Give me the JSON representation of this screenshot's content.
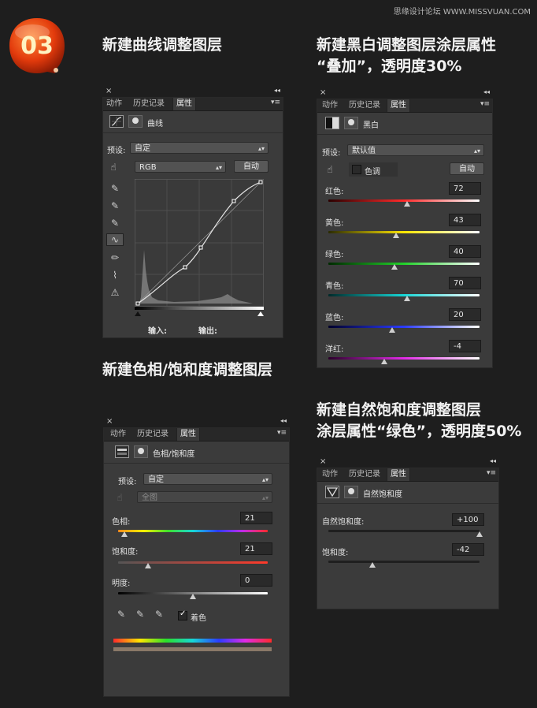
{
  "watermark": "思缘设计论坛 WWW.MISSVUAN.COM",
  "badge": {
    "text": "03",
    "color": "#e23a0c"
  },
  "headings": {
    "h1": "新建曲线调整图层",
    "h2_line1": "新建黑白调整图层涂层属性",
    "h2_line2": "“叠加”，透明度30%",
    "h3": "新建色相/饱和度调整图层",
    "h4_line1": "新建自然饱和度调整图层",
    "h4_line2": "涂层属性“绿色”，透明度50%"
  },
  "tabs": {
    "actions": "动作",
    "history": "历史记录",
    "properties": "属性"
  },
  "icons": {
    "close": "×",
    "collapse": "◂◂",
    "menu": "▾≡",
    "arrows": "▴▾"
  },
  "curves": {
    "title": "曲线",
    "preset_label": "预设:",
    "preset_value": "自定",
    "channel_value": "RGB",
    "auto_button": "自动",
    "input_label": "输入:",
    "output_label": "输出:"
  },
  "bw": {
    "title": "黑白",
    "preset_label": "预设:",
    "preset_value": "默认值",
    "tint_label": "色调",
    "auto_button": "自动",
    "sliders": [
      {
        "label": "红色:",
        "value": "72",
        "pos": 0.52,
        "gradient": "linear-gradient(to right,#2a0000,#ff2a2a,#fff)"
      },
      {
        "label": "黄色:",
        "value": "43",
        "pos": 0.45,
        "gradient": "linear-gradient(to right,#2a2a00,#ffe600,#fff)"
      },
      {
        "label": "绿色:",
        "value": "40",
        "pos": 0.44,
        "gradient": "linear-gradient(to right,#002a00,#22d12a,#fff)"
      },
      {
        "label": "青色:",
        "value": "70",
        "pos": 0.52,
        "gradient": "linear-gradient(to right,#002a2a,#17d6d6,#fff)"
      },
      {
        "label": "蓝色:",
        "value": "20",
        "pos": 0.42,
        "gradient": "linear-gradient(to right,#00002a,#2b3bff,#fff)"
      },
      {
        "label": "洋红:",
        "value": "-4",
        "pos": 0.37,
        "gradient": "linear-gradient(to right,#2a002a,#e12ae6,#fff)"
      }
    ]
  },
  "hue": {
    "title": "色相/饱和度",
    "preset_label": "预设:",
    "preset_value": "自定",
    "channel_value": "全图",
    "hue_label": "色相:",
    "hue_value": "21",
    "hue_pos": 0.04,
    "sat_label": "饱和度:",
    "sat_value": "21",
    "sat_pos": 0.2,
    "light_label": "明度:",
    "light_value": "0",
    "light_pos": 0.5,
    "colorize_label": "着色"
  },
  "vib": {
    "title": "自然饱和度",
    "vibrance_label": "自然饱和度:",
    "vibrance_value": "+100",
    "vibrance_pos": 1.0,
    "sat_label": "饱和度:",
    "sat_value": "-42",
    "sat_pos": 0.29
  }
}
